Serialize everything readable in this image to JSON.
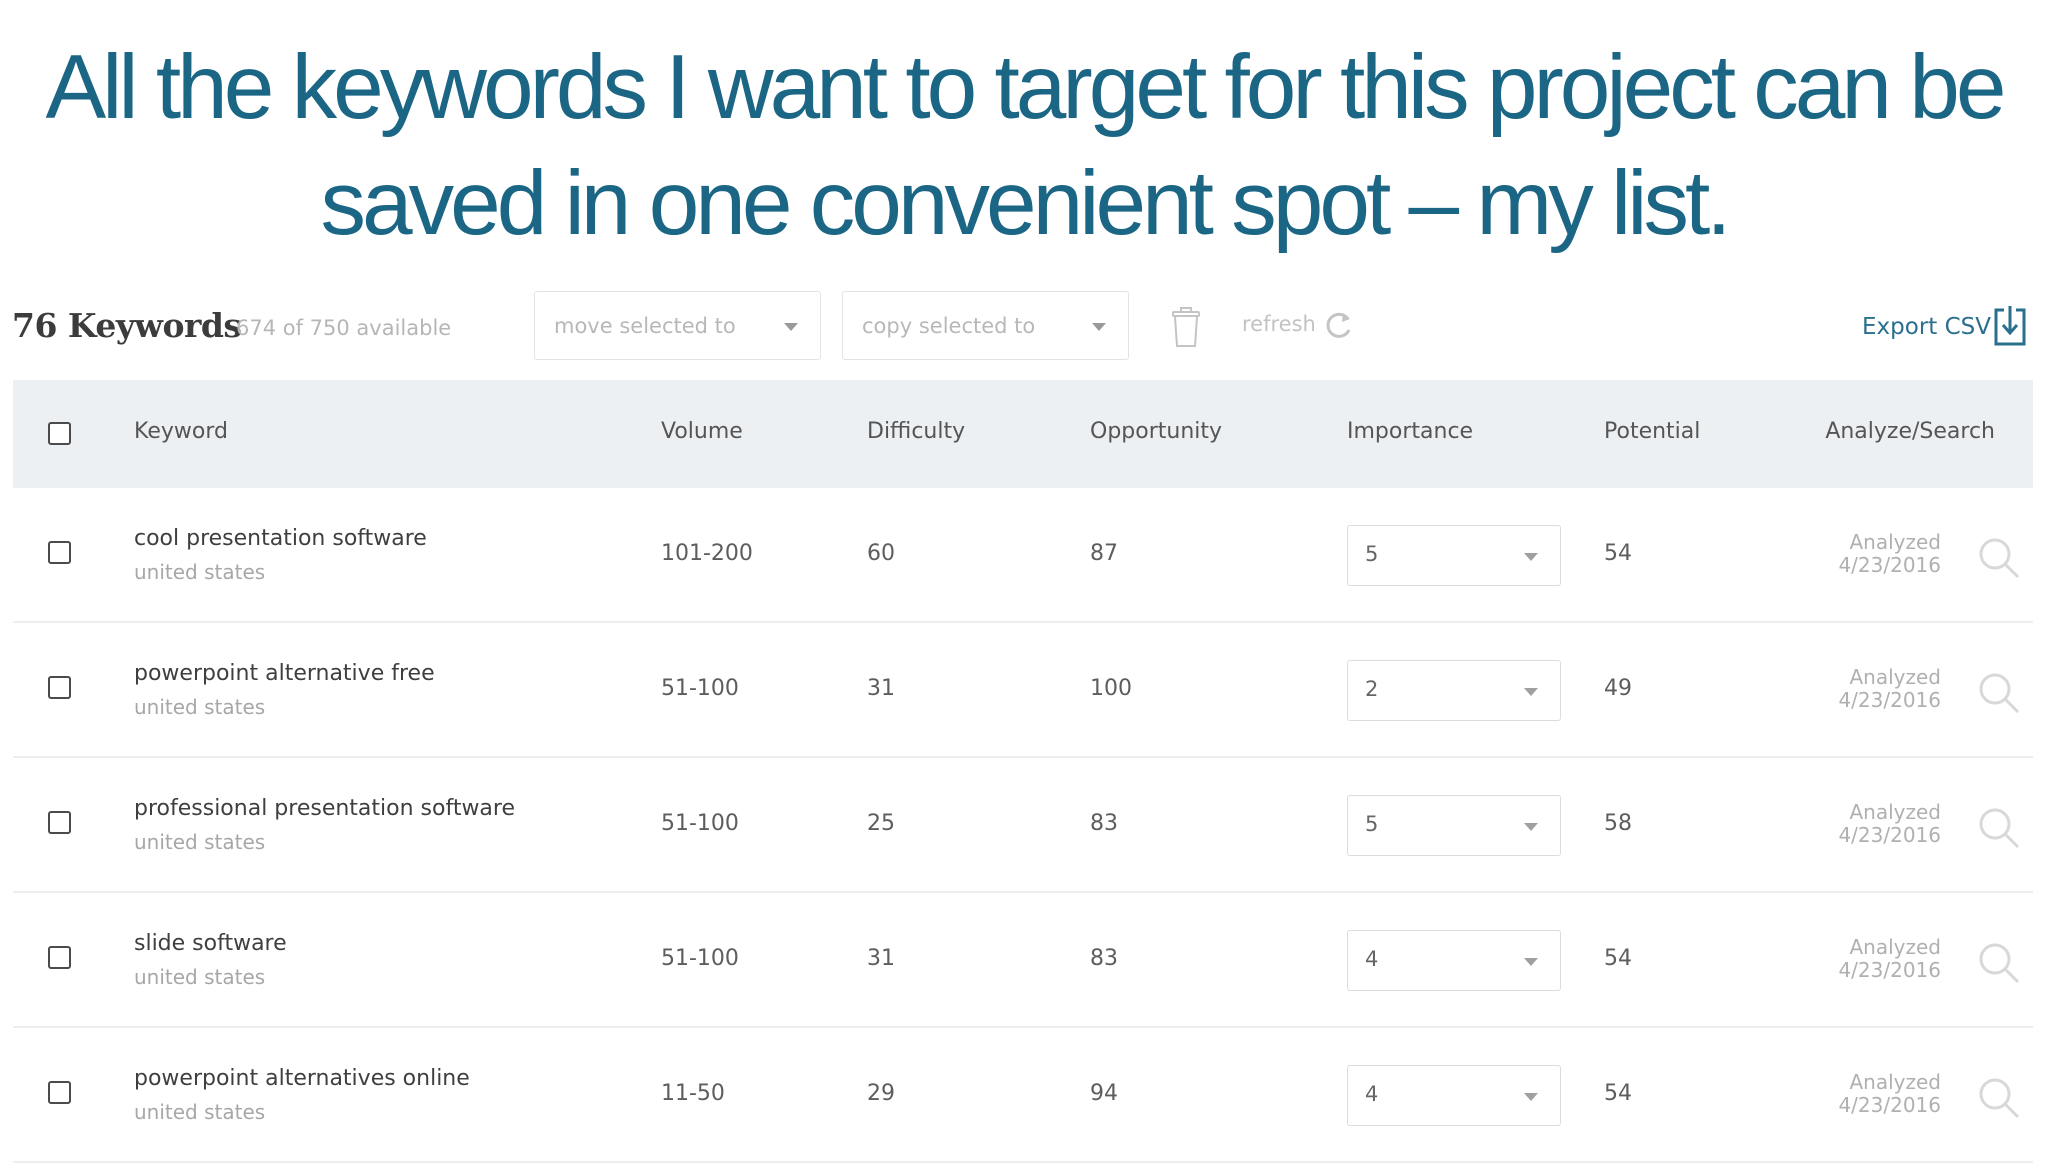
{
  "slide": {
    "title_line1": "All the keywords I want to target for this project can be",
    "title_line2": "saved in one convenient spot – my list."
  },
  "toolbar": {
    "keyword_count": "76 Keywords",
    "available": "674 of 750 available",
    "move_selected": "move selected to",
    "copy_selected": "copy selected to",
    "refresh": "refresh",
    "export": "Export CSV"
  },
  "table": {
    "headers": {
      "keyword": "Keyword",
      "volume": "Volume",
      "difficulty": "Difficulty",
      "opportunity": "Opportunity",
      "importance": "Importance",
      "potential": "Potential",
      "analyze": "Analyze/Search"
    },
    "rows": [
      {
        "keyword": "cool presentation software",
        "location": "united states",
        "volume": "101-200",
        "difficulty": "60",
        "opportunity": "87",
        "importance": "5",
        "potential": "54",
        "status": "Analyzed",
        "date": "4/23/2016"
      },
      {
        "keyword": "powerpoint alternative free",
        "location": "united states",
        "volume": "51-100",
        "difficulty": "31",
        "opportunity": "100",
        "importance": "2",
        "potential": "49",
        "status": "Analyzed",
        "date": "4/23/2016"
      },
      {
        "keyword": "professional presentation software",
        "location": "united states",
        "volume": "51-100",
        "difficulty": "25",
        "opportunity": "83",
        "importance": "5",
        "potential": "58",
        "status": "Analyzed",
        "date": "4/23/2016"
      },
      {
        "keyword": "slide software",
        "location": "united states",
        "volume": "51-100",
        "difficulty": "31",
        "opportunity": "83",
        "importance": "4",
        "potential": "54",
        "status": "Analyzed",
        "date": "4/23/2016"
      },
      {
        "keyword": "powerpoint alternatives online",
        "location": "united states",
        "volume": "11-50",
        "difficulty": "29",
        "opportunity": "94",
        "importance": "4",
        "potential": "54",
        "status": "Analyzed",
        "date": "4/23/2016"
      }
    ]
  },
  "colors": {
    "title": "#1c6685",
    "accent": "#2a6f8e",
    "header_bg": "#edf0f3"
  },
  "icons": [
    "trash-icon",
    "refresh-icon",
    "download-icon",
    "search-icon",
    "chevron-down-icon"
  ]
}
